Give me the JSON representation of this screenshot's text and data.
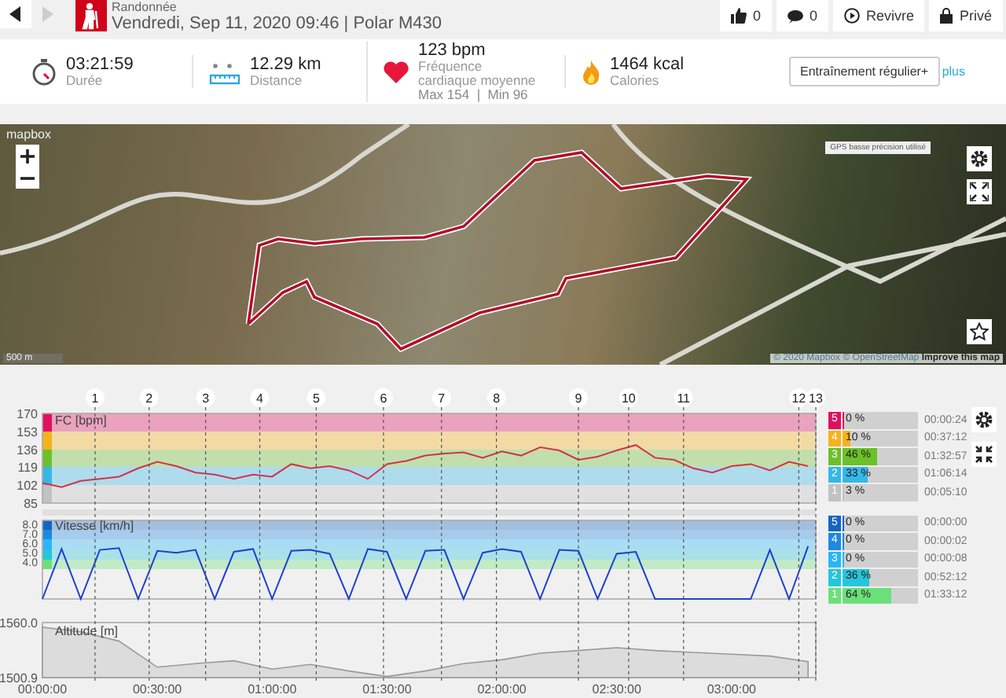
{
  "header": {
    "title": "Randonnée",
    "subtitle": "Vendredi, Sep 11, 2020 09:46 | Polar M430",
    "actions": [
      {
        "kind": "like",
        "label": "0"
      },
      {
        "kind": "comment",
        "label": "0"
      },
      {
        "kind": "replay",
        "label": "Revivre"
      },
      {
        "kind": "lock",
        "label": "Privé"
      }
    ]
  },
  "stats": [
    {
      "kind": "duration",
      "value": "03:21:59",
      "label": "Durée"
    },
    {
      "kind": "distance",
      "value": "12.29 km",
      "label": "Distance"
    },
    {
      "kind": "heart",
      "value": "123 bpm",
      "label": "Fréquence cardiaque moyenne",
      "detail": "Max 154  |  Min 96"
    },
    {
      "kind": "calories",
      "value": "1464 kcal",
      "label": "Calories"
    }
  ],
  "training_type_button": "Entraînement régulier+",
  "more_link": "plus",
  "map": {
    "logo": "mapbox",
    "legend": "GPS basse précision utilisé",
    "scale": "500 m",
    "attribution": "© 2020 Mapbox © OpenStreetMap",
    "attribution_link": "Improve this map"
  },
  "charts": {
    "markers": [
      "1",
      "2",
      "3",
      "4",
      "5",
      "6",
      "7",
      "8",
      "9",
      "10",
      "11",
      "12",
      "13"
    ],
    "hr": {
      "chart_data": {
        "type": "line",
        "title": "FC [bpm]",
        "xlim": [
          0,
          202
        ],
        "ylim": [
          85,
          170
        ],
        "yticks": [
          170,
          153,
          136,
          119,
          102,
          85
        ],
        "x": [
          0,
          5,
          10,
          15,
          20,
          25,
          30,
          35,
          40,
          45,
          50,
          55,
          60,
          65,
          70,
          75,
          80,
          85,
          90,
          95,
          100,
          105,
          110,
          115,
          120,
          125,
          130,
          135,
          140,
          145,
          150,
          155,
          160,
          165,
          170,
          175,
          180,
          185,
          190,
          195,
          200
        ],
        "series": [
          {
            "color": "#d2334a",
            "values": [
              104,
              100,
              106,
              108,
              110,
              118,
              124,
              120,
              114,
              112,
              108,
              112,
              110,
              122,
              118,
              120,
              116,
              108,
              122,
              125,
              130,
              132,
              133,
              128,
              134,
              130,
              138,
              135,
              126,
              129,
              135,
              140,
              128,
              126,
              118,
              114,
              120,
              122,
              116,
              124,
              120
            ]
          }
        ]
      }
    },
    "speed": {
      "chart_data": {
        "type": "line",
        "title": "Vitesse [km/h]",
        "xlim": [
          0,
          202
        ],
        "ylim": [
          0,
          8.33
        ],
        "yticks": [
          {
            "value": 8,
            "label": "8.0"
          },
          {
            "value": 7,
            "label": "7.0"
          },
          {
            "value": 6,
            "label": "6.0"
          },
          {
            "value": 5,
            "label": "5.0"
          },
          {
            "value": 4,
            "label": "4.0"
          }
        ],
        "x": [
          0,
          5,
          10,
          15,
          20,
          25,
          30,
          35,
          40,
          45,
          50,
          55,
          60,
          65,
          70,
          75,
          80,
          85,
          90,
          95,
          100,
          105,
          110,
          115,
          120,
          125,
          130,
          135,
          140,
          145,
          150,
          155,
          160,
          165,
          170,
          175,
          180,
          185,
          190,
          195,
          200
        ],
        "series": [
          {
            "color": "#1f3fd0",
            "values": [
              0,
              5.3,
              0,
              5.2,
              5.4,
              0,
              5.1,
              4.9,
              5.2,
              0,
              5.0,
              5.3,
              0,
              5.1,
              5.2,
              4.8,
              0,
              5.3,
              5.0,
              0,
              5.1,
              5.2,
              0,
              4.9,
              5.3,
              5.0,
              0,
              5.2,
              5.1,
              0,
              4.8,
              5.0,
              0,
              0,
              0,
              0,
              0,
              0,
              5.2,
              0,
              5.6
            ]
          }
        ]
      }
    },
    "altitude": {
      "chart_data": {
        "type": "area",
        "title": "Altitude [m]",
        "xlim": [
          0,
          202
        ],
        "ylim": [
          1500.9,
          1560.0
        ],
        "yticks": [
          {
            "value": 1560,
            "label": "1560.0"
          },
          1500.9
        ],
        "xticks": [
          {
            "value": 0,
            "label": "00:00:00"
          },
          {
            "value": 30,
            "label": "00:30:00"
          },
          {
            "value": 60,
            "label": "01:00:00"
          },
          {
            "value": 90,
            "label": "01:30:00"
          },
          {
            "value": 120,
            "label": "02:00:00"
          },
          {
            "value": 150,
            "label": "02:30:00"
          },
          {
            "value": 180,
            "label": "03:00:00"
          }
        ],
        "x": [
          0,
          10,
          20,
          30,
          40,
          50,
          60,
          70,
          80,
          90,
          100,
          110,
          120,
          130,
          140,
          150,
          160,
          170,
          180,
          190,
          200
        ],
        "series": [
          {
            "color": "#dcdcdc",
            "values": [
              1555,
              1550,
              1540,
              1512,
              1516,
              1519,
              1510,
              1515,
              1508,
              1502,
              1508,
              1516,
              1520,
              1527,
              1530,
              1533,
              1530,
              1528,
              1526,
              1524,
              1518
            ]
          }
        ]
      }
    }
  },
  "hr_zones": [
    {
      "zone": "5",
      "percent": "0 %",
      "time": "00:00:24",
      "level": 0.0,
      "color": "#e0115f"
    },
    {
      "zone": "4",
      "percent": "10 %",
      "time": "00:37:12",
      "level": 0.1,
      "color": "#f5b21b"
    },
    {
      "zone": "3",
      "percent": "46 %",
      "time": "01:32:57",
      "level": 0.46,
      "color": "#6cc12a"
    },
    {
      "zone": "2",
      "percent": "33 %",
      "time": "01:06:14",
      "level": 0.33,
      "color": "#35b8e8"
    },
    {
      "zone": "1",
      "percent": "3 %",
      "time": "00:05:10",
      "level": 0.03,
      "color": "#c2c2c2"
    }
  ],
  "speed_zones": [
    {
      "zone": "5",
      "percent": "0 %",
      "time": "00:00:00",
      "level": 0.0,
      "color": "#1565c0"
    },
    {
      "zone": "4",
      "percent": "0 %",
      "time": "00:00:02",
      "level": 0.0,
      "color": "#1e88e5"
    },
    {
      "zone": "3",
      "percent": "0 %",
      "time": "00:00:08",
      "level": 0.0,
      "color": "#29b6f6"
    },
    {
      "zone": "2",
      "percent": "36 %",
      "time": "00:52:12",
      "level": 0.36,
      "color": "#26c6da"
    },
    {
      "zone": "1",
      "percent": "64 %",
      "time": "01:33:12",
      "level": 0.64,
      "color": "#6be07a"
    }
  ]
}
